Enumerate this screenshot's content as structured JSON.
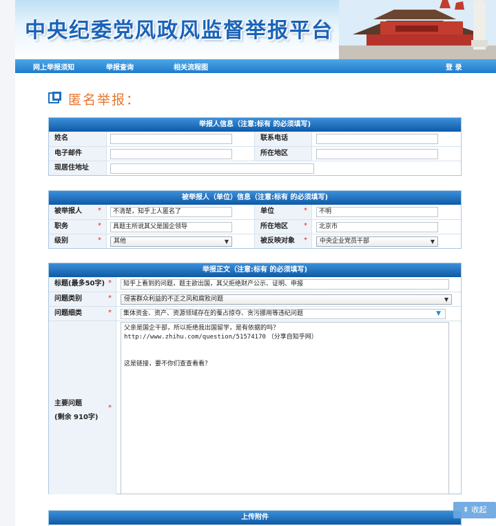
{
  "site": {
    "title": "中央纪委党风政风监督举报平台"
  },
  "nav": {
    "items": [
      "网上举报须知",
      "举报查询",
      "相关流程图"
    ],
    "login": "登 录"
  },
  "page": {
    "heading": "匿名举报："
  },
  "reporter_section": {
    "header": "举报人信息（注意:标有 的必须填写)",
    "name_label": "姓名",
    "phone_label": "联系电话",
    "email_label": "电子邮件",
    "region_label": "所在地区",
    "address_label": "现居住地址"
  },
  "reported_section": {
    "header": "被举报人（单位）信息（注意:标有 的必须填写)",
    "person_label": "被举报人",
    "person_value": "不清楚，知乎上人匿名了",
    "unit_label": "单位",
    "unit_value": "不明",
    "position_label": "职务",
    "position_value": "具题主所说其父是国企领导",
    "region_label": "所在地区",
    "region_value": "北京市",
    "level_label": "级别",
    "level_value": "其他",
    "target_label": "被反映对象",
    "target_value": "中央企业党员干部"
  },
  "content_section": {
    "header": "举报正文（注意:标有 的必须填写)",
    "title_label": "标题(最多50字)",
    "title_value": "知乎上看到的问题，题主欲出国，其父拒绝财产公示、证明、申报",
    "category_label": "问题类别",
    "category_value": "侵害群众利益的不正之风和腐败问题",
    "subcategory_label": "问题细类",
    "subcategory_value": "集体资金、资产、资源领域存在的蚕占掠夺、贪污挪用等违纪问题",
    "main_label": "主要问题",
    "main_remaining": "(剩余 910字)",
    "main_line1": "父亲是国企干部，所以拒绝我出国留学，是有依据的吗？",
    "main_url": "http://www.zhihu.com/question/51574170",
    "main_share": "（分享自知乎网）",
    "main_line3": "这是链接，要不你们查查看看？"
  },
  "upload_section": {
    "header": "上传附件"
  },
  "ui": {
    "required_mark": "*",
    "collapse": "收起"
  },
  "colors": {
    "nav_blue": "#1f7ccc",
    "header_blue": "#0d5aa8",
    "heading_orange": "#e9742b",
    "required_red": "#e21f1f"
  }
}
